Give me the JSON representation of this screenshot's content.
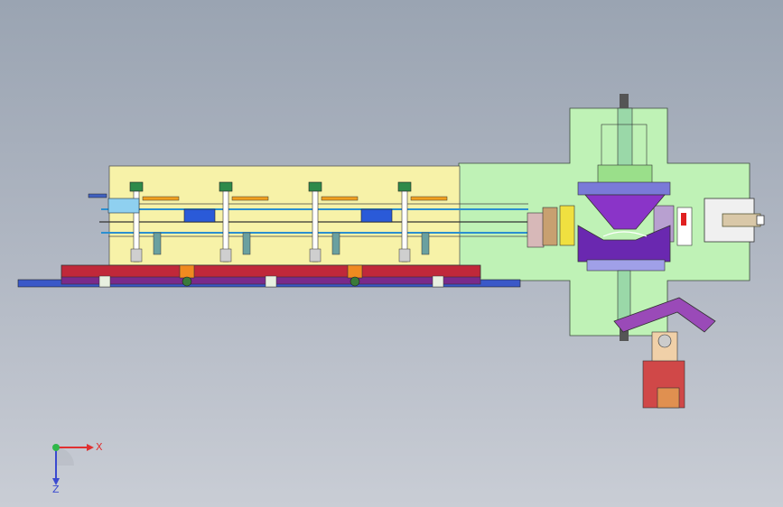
{
  "viewport": {
    "background_top": "#9aa4b2",
    "background_bottom": "#c9cdd5"
  },
  "triad": {
    "x_label": "X",
    "y_label": "Y",
    "z_label": "Z",
    "x_color": "#e03030",
    "y_color": "#2fb84a",
    "z_color": "#3a4ad0"
  },
  "model": {
    "base_plate_color": "#f7f2a8",
    "cross_plate_color": "#bff2b6",
    "rail_color": "#c0283a",
    "press_color": "#8a34c8",
    "station_count": 4
  }
}
